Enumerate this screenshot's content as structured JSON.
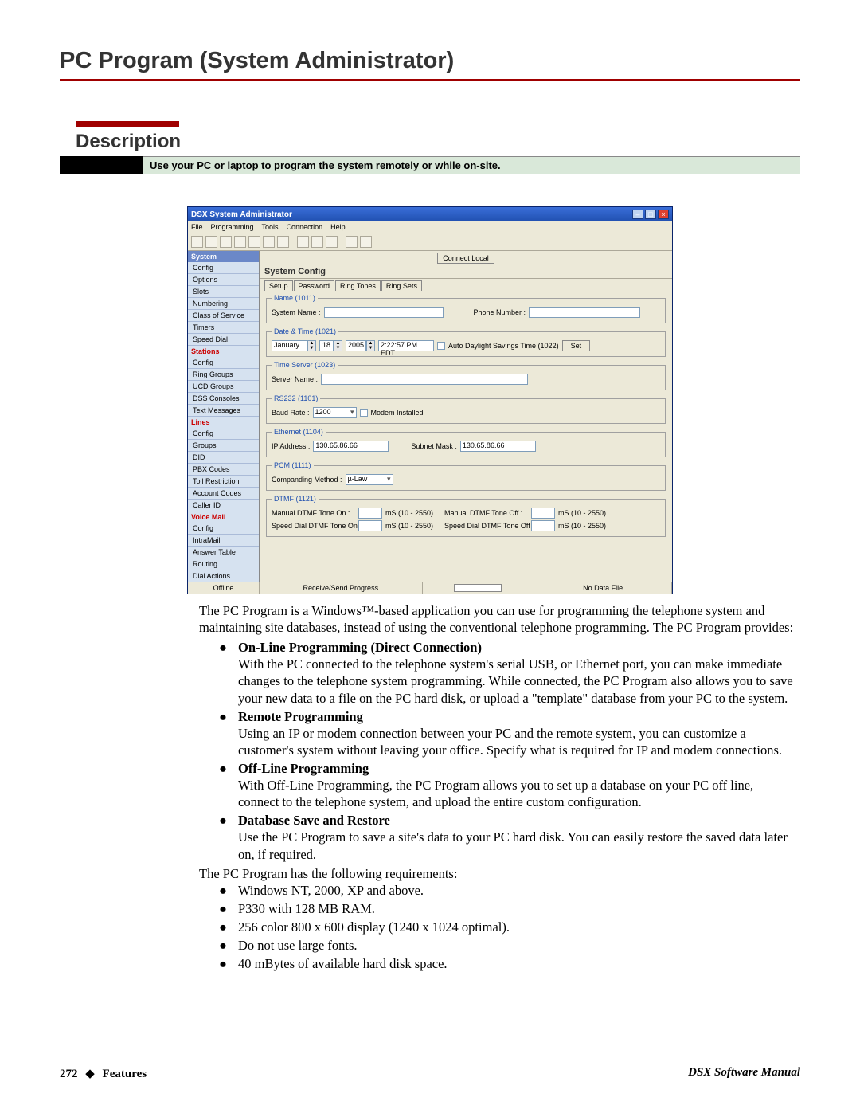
{
  "page_title": "PC Program (System Administrator)",
  "section_title": "Description",
  "shaded_intro": "Use your PC or laptop to program the system remotely or while on-site.",
  "app": {
    "title": "DSX System Administrator",
    "menus": [
      "File",
      "Programming",
      "Tools",
      "Connection",
      "Help"
    ],
    "connect_button": "Connect Local",
    "content_title": "System Config",
    "tabs": [
      "Setup",
      "Password",
      "Ring Tones",
      "Ring Sets"
    ],
    "tree": {
      "system": "System",
      "system_items": [
        "Config",
        "Options",
        "Slots",
        "Numbering",
        "Class of Service",
        "Timers",
        "Speed Dial"
      ],
      "stations": "Stations",
      "stations_items": [
        "Config",
        "Ring Groups",
        "UCD Groups",
        "DSS Consoles",
        "Text Messages"
      ],
      "lines": "Lines",
      "lines_items": [
        "Config",
        "Groups",
        "DID",
        "PBX Codes",
        "Toll Restriction",
        "Account Codes",
        "Caller ID"
      ],
      "voicemail": "Voice Mail",
      "voicemail_items": [
        "Config",
        "IntraMail",
        "Answer Table",
        "Routing",
        "Dial Actions"
      ]
    },
    "groups": {
      "name": {
        "legend": "Name (1011)",
        "system_name_lbl": "System Name :",
        "phone_lbl": "Phone Number :"
      },
      "datetime": {
        "legend": "Date & Time (1021)",
        "month": "January",
        "day": "18",
        "year": "2005",
        "time": "2:22:57 PM EDT",
        "auto_dst": "Auto Daylight Savings Time (1022)",
        "set_btn": "Set"
      },
      "timeserver": {
        "legend": "Time Server (1023)",
        "server_name_lbl": "Server Name :"
      },
      "rs232": {
        "legend": "RS232 (1101)",
        "baud_lbl": "Baud Rate :",
        "baud_val": "1200",
        "modem_lbl": "Modem Installed"
      },
      "ethernet": {
        "legend": "Ethernet (1104)",
        "ip_lbl": "IP Address :",
        "ip_val": "130.65.86.66",
        "mask_lbl": "Subnet Mask :",
        "mask_val": "130.65.86.66"
      },
      "pcm": {
        "legend": "PCM (1111)",
        "comp_lbl": "Companding Method :",
        "comp_val": "µ-Law"
      },
      "dtmf": {
        "legend": "DTMF (1121)",
        "manual_on": "Manual DTMF Tone On :",
        "manual_off": "Manual DTMF Tone Off :",
        "speed_on": "Speed Dial DTMF Tone On :",
        "speed_off": "Speed Dial DTMF Tone Off :",
        "range": "mS (10 - 2550)"
      }
    },
    "status": {
      "offline": "Offline",
      "progress": "Receive/Send Progress",
      "nodata": "No Data File"
    }
  },
  "intro_para": "The PC Program is a Windows™-based application you can use for programming the telephone system and maintaining site databases, instead of using the conventional telephone programming. The PC Program provides:",
  "bullets": [
    {
      "head": "On-Line Programming (Direct Connection)",
      "body": "With the PC connected to the telephone system's serial USB, or Ethernet port, you can make immediate changes to the telephone system programming. While connected, the PC Program also allows you to save your new data to a file on the PC hard disk, or upload a \"template\" database from your PC to the system."
    },
    {
      "head": "Remote Programming",
      "body": "Using an IP or modem connection between your PC and the remote system, you can customize a customer's system without leaving your office. Specify what is required for IP and modem connections."
    },
    {
      "head": "Off-Line Programming",
      "body": "With Off-Line Programming, the PC Program allows you to set up a database on your PC off line, connect to the telephone system, and upload the entire custom configuration."
    },
    {
      "head": "Database Save and Restore",
      "body": "Use the PC Program to save a site's data to your PC hard disk. You can easily restore the saved data later on, if required."
    }
  ],
  "req_intro": "The PC Program has the following requirements:",
  "reqs": [
    "Windows NT, 2000, XP and above.",
    "P330 with 128 MB RAM.",
    "256 color 800 x 600 display (1240 x 1024 optimal).",
    "Do not use large fonts.",
    "40 mBytes of available hard disk space."
  ],
  "footer": {
    "page_num": "272",
    "diamond": "◆",
    "section": "Features",
    "manual": "DSX Software Manual"
  }
}
